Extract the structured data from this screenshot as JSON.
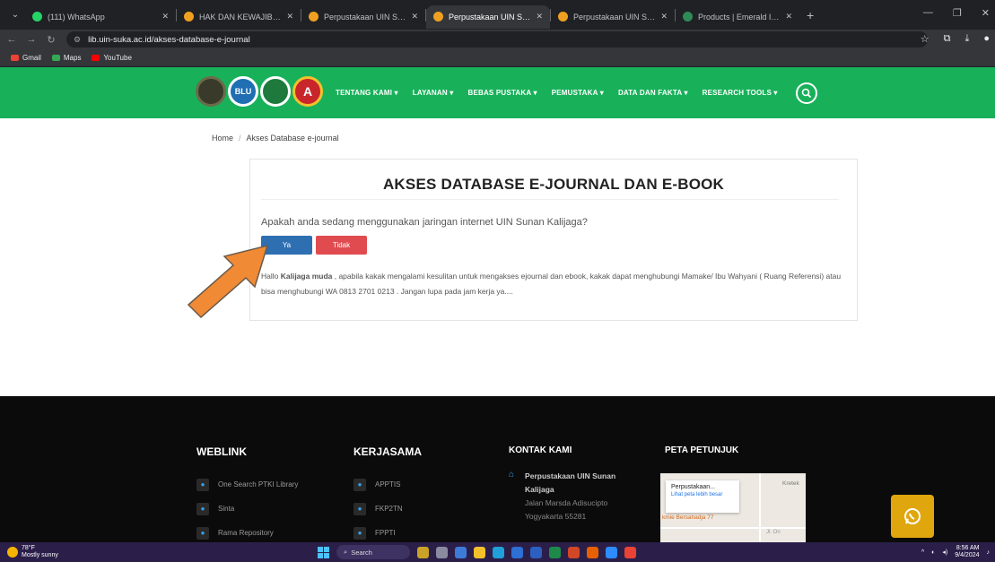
{
  "browser": {
    "tabs": [
      {
        "title": "(111) WhatsApp",
        "fav_color": "#25d366",
        "active": false
      },
      {
        "title": "HAK DAN KEWAJIBAN ISTRI DA",
        "fav_color": "#f0a020",
        "active": false
      },
      {
        "title": "Perpustakaan UIN Sunan Kalija",
        "fav_color": "#f0a020",
        "active": false
      },
      {
        "title": "Perpustakaan UIN Sunan Kalija",
        "fav_color": "#f0a020",
        "active": true
      },
      {
        "title": "Perpustakaan UIN Sunan Kalija",
        "fav_color": "#f0a020",
        "active": false
      },
      {
        "title": "Products | Emerald Insight",
        "fav_color": "#2e8b57",
        "active": false
      }
    ],
    "url": "lib.uin-suka.ac.id/akses-database-e-journal",
    "bookmarks": [
      {
        "label": "Gmail",
        "color": "#ea4335"
      },
      {
        "label": "Maps",
        "color": "#34a853"
      },
      {
        "label": "YouTube",
        "color": "#ff0000"
      }
    ]
  },
  "nav": {
    "logos": [
      "",
      "BLU",
      "",
      "A"
    ],
    "menu": [
      "TENTANG KAMI ▾",
      "LAYANAN ▾",
      "BEBAS PUSTAKA ▾",
      "PEMUSTAKA ▾",
      "DATA DAN FAKTA ▾",
      "RESEARCH TOOLS ▾"
    ]
  },
  "breadcrumb": {
    "home": "Home",
    "sep": "/",
    "current": "Akses Database e-journal"
  },
  "card": {
    "title": "AKSES DATABASE E-JOURNAL DAN E-BOOK",
    "question": "Apakah anda sedang menggunakan jaringan internet UIN Sunan Kalijaga?",
    "btn_yes": "Ya",
    "btn_no": "Tidak",
    "note_prefix": "Hallo ",
    "note_bold": "Kalijaga muda",
    "note_rest": " , apabila kakak mengalami kesulitan untuk mengakses ejournal dan ebook, kakak dapat menghubungi Mamake/ Ibu Wahyani ( Ruang Referensi) atau bisa menghubungi WA 0813 2701 0213 . Jangan lupa pada jam kerja ya...."
  },
  "footer": {
    "weblink": {
      "title": "WEBLINK",
      "items": [
        "One Search PTKI Library",
        "Sinta",
        "Rama Repository"
      ]
    },
    "kerjasama": {
      "title": "KERJASAMA",
      "items": [
        "APPTIS",
        "FKP2TN",
        "FPPTI"
      ]
    },
    "kontak": {
      "title": "KONTAK KAMI",
      "name": "Perpustakaan UIN Sunan Kalijaga",
      "address1": "Jalan Marsda Adisucipto",
      "address2": "Yogyakarta 55281"
    },
    "peta": {
      "title": "PETA PETUNJUK",
      "map_title": "Perpustakaan...",
      "map_link": "Lihat peta lebih besar",
      "map_place": "kmie Bersahadja 77",
      "map_kretek": "Kretek",
      "map_road": "Jl. On"
    }
  },
  "taskbar": {
    "temp": "78°F",
    "weather": "Mostly sunny",
    "search": "Search",
    "time": "8:56 AM",
    "date": "9/4/2024"
  }
}
